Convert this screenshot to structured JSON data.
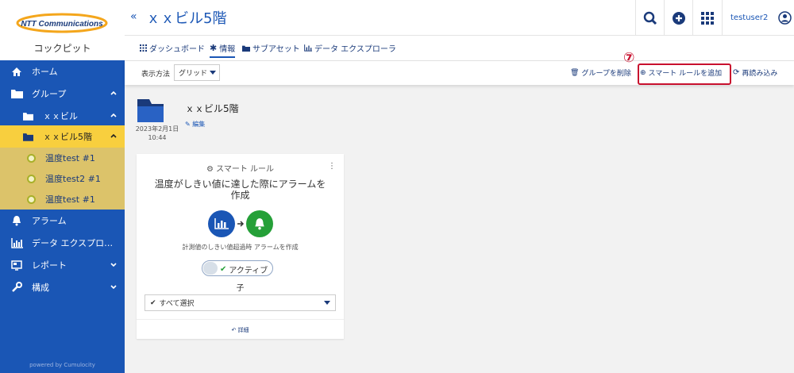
{
  "brand": {
    "logo_text": "NTT Communications",
    "app_name": "コックピット",
    "powered": "powered by Cumulocity"
  },
  "nav": {
    "home": "ホーム",
    "group": "グループ",
    "building": "ｘｘビル",
    "floor": "ｘｘビル5階",
    "devices": [
      "温度test #1",
      "温度test2 #1",
      "温度test #1"
    ],
    "alarm": "アラーム",
    "data_explorer": "データ エクスプロ…",
    "report": "レポート",
    "config": "構成"
  },
  "header": {
    "collapse": "«",
    "title": "ｘｘビル5階",
    "username": "testuser2"
  },
  "tabs": [
    "ダッシュボード",
    "情報",
    "サブアセット",
    "データ エクスプローラ"
  ],
  "actionbar": {
    "view_label": "表示方法",
    "view_value": "グリッド",
    "delete_group": "グループを削除",
    "add_smart_rule": "スマート ルールを追加",
    "reload": "再読み込み",
    "marker": "⑦"
  },
  "group_info": {
    "name": "ｘｘビル5階",
    "edit": "編集",
    "date": "2023年2月1日",
    "time": "10:44"
  },
  "card": {
    "header": "スマート ルール",
    "title": "温度がしきい値に達した際にアラームを作成",
    "description": "計測値のしきい値超過時 アラームを作成",
    "status": "アクティブ",
    "child_label": "子",
    "select_value": "すべて選択",
    "detail": "詳細"
  },
  "colors": {
    "primary": "#1a56b5",
    "accent": "#f8cf3e",
    "alarm_green": "#25a038",
    "highlight": "#c8102e"
  }
}
